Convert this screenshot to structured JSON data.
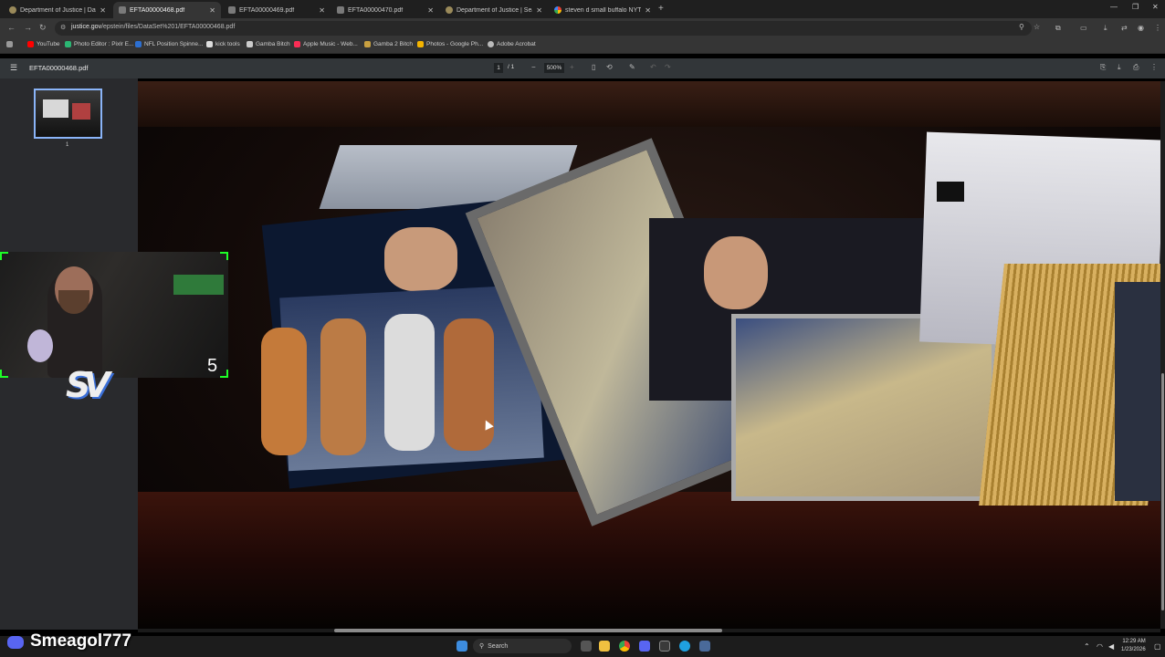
{
  "browser": {
    "tabs": [
      {
        "title": "Department of Justice | Data Se",
        "favicon": "doj-icon",
        "active": false
      },
      {
        "title": "EFTA00000468.pdf",
        "favicon": "pdf-icon",
        "active": true
      },
      {
        "title": "EFTA00000469.pdf",
        "favicon": "pdf-icon",
        "active": false
      },
      {
        "title": "EFTA00000470.pdf",
        "favicon": "pdf-icon",
        "active": false
      },
      {
        "title": "Department of Justice | Search",
        "favicon": "doj-icon",
        "active": false
      },
      {
        "title": "steven d small buffalo NYT - Go",
        "favicon": "google-icon",
        "active": false
      }
    ],
    "new_tab": "+",
    "url_host": "justice.gov",
    "url_path": "/epstein/files/DataSet%201/EFTA00000468.pdf",
    "bookmarks": [
      {
        "label": "YouTube",
        "color": "#ff0000"
      },
      {
        "label": "Photo Editor : Pixlr E...",
        "color": "#2bb673"
      },
      {
        "label": "NFL Position Spinne...",
        "color": "#2c6fd1"
      },
      {
        "label": "kick tools",
        "color": "#dddddd"
      },
      {
        "label": "Gamba Bitch",
        "color": "#cccccc"
      },
      {
        "label": "Apple Music - Web...",
        "color": "#fa2d55"
      },
      {
        "label": "Gamba 2 Bitch",
        "color": "#c8a040"
      },
      {
        "label": "Photos - Google Ph...",
        "color": "#f4b400"
      },
      {
        "label": "Adobe Acrobat",
        "color": "#bbbbbb"
      }
    ]
  },
  "pdf": {
    "filename": "EFTA00000468.pdf",
    "page_current": "1",
    "page_total": "/ 1",
    "zoom": "500%",
    "thumbnail_page": "1"
  },
  "overlay": {
    "counter": "5",
    "logo": "SV",
    "username": "Smeagol777"
  },
  "taskbar": {
    "search_placeholder": "Search",
    "time": "12:29 AM",
    "date": "1/23/2026"
  }
}
